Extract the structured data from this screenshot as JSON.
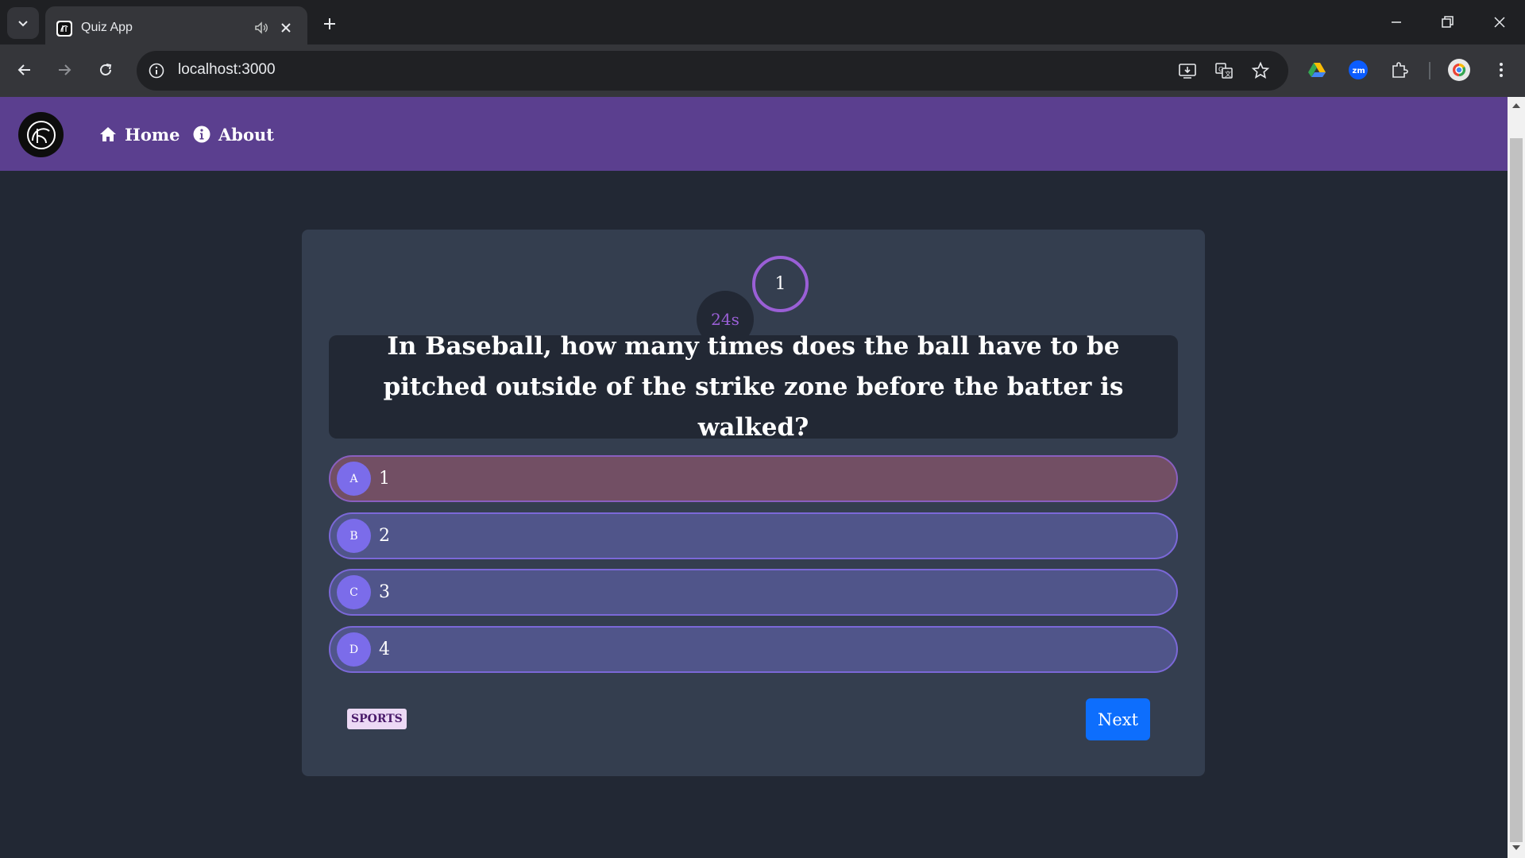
{
  "browser": {
    "tab_title": "Quiz App",
    "url": "localhost:3000"
  },
  "navbar": {
    "links": [
      {
        "label": "Home",
        "icon": "home-icon"
      },
      {
        "label": "About",
        "icon": "info-icon"
      }
    ],
    "color": "#5b3f8f"
  },
  "quiz": {
    "question_number": "1",
    "timer": "24s",
    "question": "In Baseball, how many times does the ball have to be pitched outside of the strike zone before the batter is walked?",
    "options": [
      {
        "letter": "A",
        "text": "1",
        "state": "wrong"
      },
      {
        "letter": "B",
        "text": "2",
        "state": "default"
      },
      {
        "letter": "C",
        "text": "3",
        "state": "default"
      },
      {
        "letter": "D",
        "text": "4",
        "state": "default"
      }
    ],
    "category": "SPORTS",
    "next_label": "Next",
    "colors": {
      "accent": "#9a5fd6",
      "option_bg": "#50558a",
      "option_wrong_bg": "#724f64",
      "next_button": "#0d6efd"
    }
  }
}
